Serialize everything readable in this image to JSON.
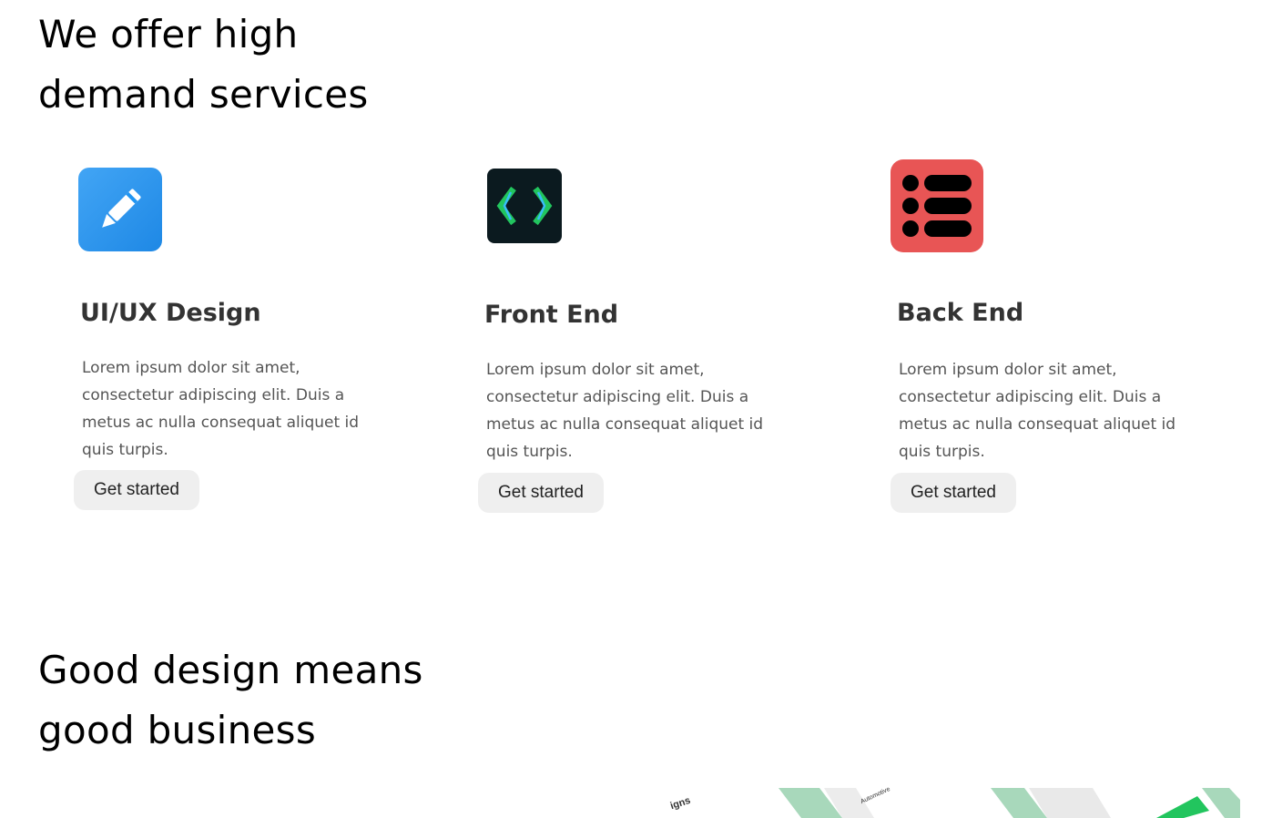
{
  "services_section": {
    "heading_line1": "We offer high",
    "heading_line2": "demand services",
    "cards": [
      {
        "icon": "pencil-icon",
        "icon_color": "#2196F3",
        "title": "UI/UX Design",
        "description": "Lorem ipsum dolor sit amet, consectetur adipiscing elit. Duis a metus ac nulla consequat aliquet id quis turpis.",
        "button_label": "Get started"
      },
      {
        "icon": "code-brackets-icon",
        "icon_color": "#0b1a1f",
        "title": "Front End",
        "description": "Lorem ipsum dolor sit amet, consectetur adipiscing elit. Duis a metus ac nulla consequat aliquet id quis turpis.",
        "button_label": "Get started"
      },
      {
        "icon": "list-icon",
        "icon_color": "#E85555",
        "title": "Back End",
        "description": "Lorem ipsum dolor sit amet, consectetur adipiscing elit. Duis a metus ac nulla consequat aliquet id quis turpis.",
        "button_label": "Get started"
      }
    ]
  },
  "design_section": {
    "heading_line1": "Good design means",
    "heading_line2": "good business",
    "preview_labels": [
      "igns",
      "Automotive"
    ],
    "accent_color": "#a8d8bb"
  }
}
